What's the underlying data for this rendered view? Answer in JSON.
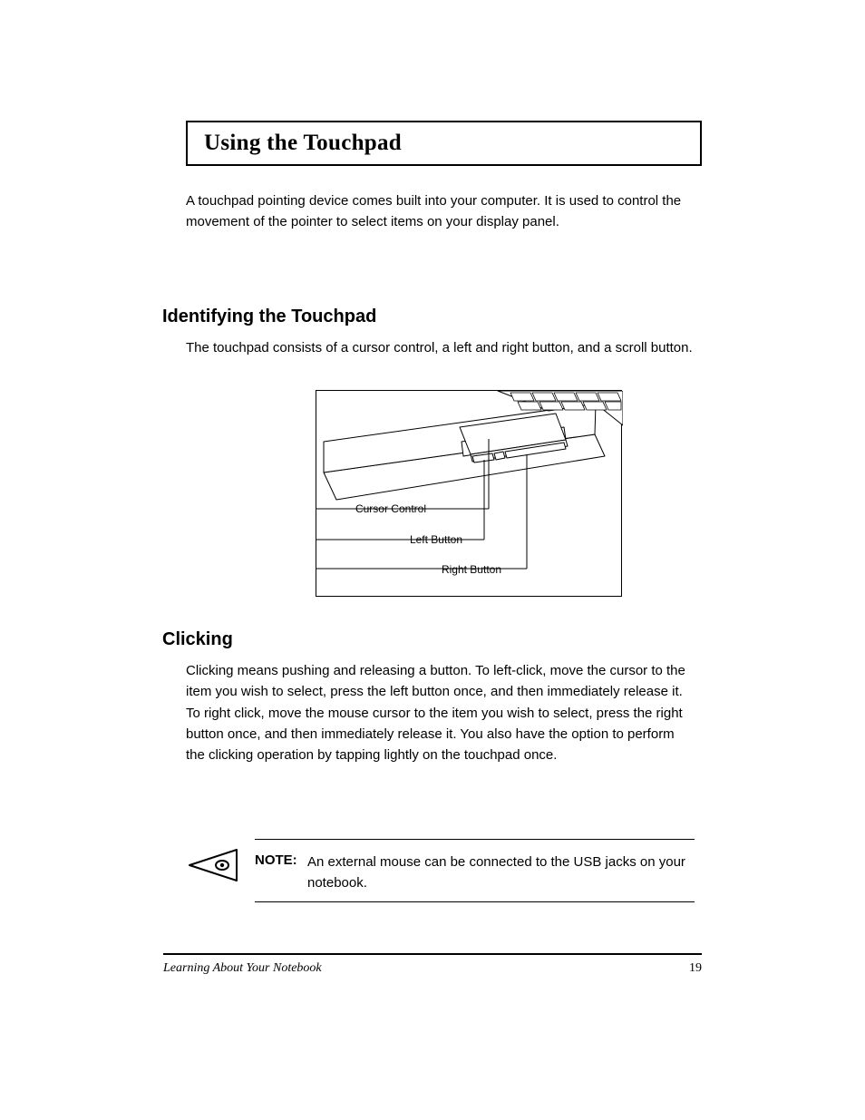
{
  "title": "Using the Touchpad",
  "intro": "A touchpad pointing device comes built into your computer. It is used to control the movement of the pointer to select items on your display panel.",
  "heading1": "Identifying the Touchpad",
  "body1": "The touchpad consists of a cursor control, a left and right button, and a scroll button.",
  "callouts": {
    "c1": "Cursor Control",
    "c2": "Left Button",
    "c3": "Right Button"
  },
  "heading2": "Clicking",
  "body2": "Clicking means pushing and releasing a button. To left-click, move the cursor to the item you wish to select, press the left button once, and then immediately release it. To right click, move the mouse cursor to the item you wish to select, press the right button once, and then immediately release it. You also have the option to perform the clicking operation by tapping lightly on the touchpad once.",
  "note_label": "NOTE:",
  "note_text": "An external mouse can be connected to the USB jacks on your notebook.",
  "footer_left": "Learning About Your Notebook",
  "footer_page": "19"
}
